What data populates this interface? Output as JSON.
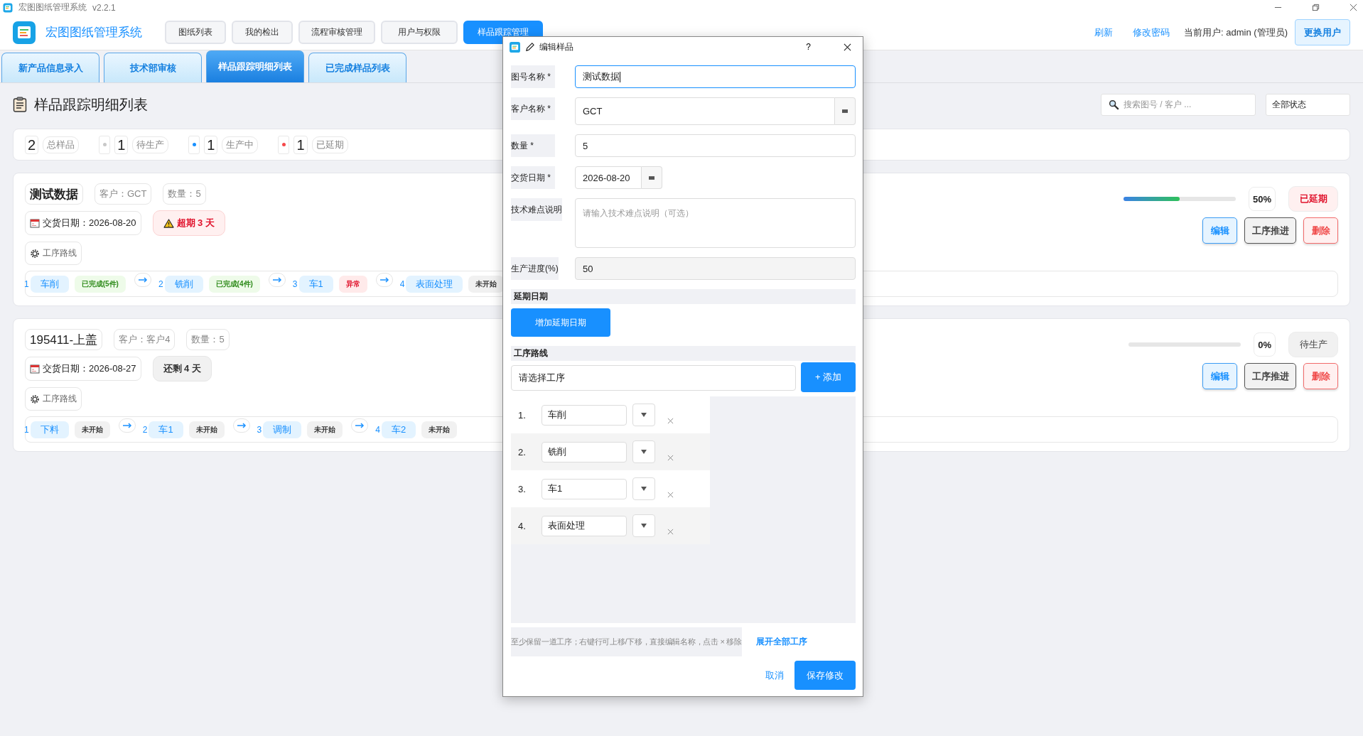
{
  "window": {
    "title": "宏图图纸管理系统",
    "version": "v2.2.1"
  },
  "header": {
    "app_name": "宏图图纸管理系统",
    "nav": [
      {
        "label": "图纸列表",
        "selected": false
      },
      {
        "label": "我的检出",
        "selected": false
      },
      {
        "label": "流程审核管理",
        "selected": false
      },
      {
        "label": "用户与权限",
        "selected": false
      },
      {
        "label": "样品跟踪管理",
        "selected": true
      }
    ],
    "links": [
      "刷新",
      "修改密码"
    ],
    "current_user": "当前用户: admin (管理员)",
    "switch_user": "更换用户"
  },
  "tabs": [
    {
      "label": "新产品信息录入",
      "selected": false
    },
    {
      "label": "技术部审核",
      "selected": false
    },
    {
      "label": "样品跟踪明细列表",
      "selected": true
    },
    {
      "label": "已完成样品列表",
      "selected": false
    }
  ],
  "page": {
    "title": "样品跟踪明细列表",
    "search": {
      "placeholder": "搜索图号 / 客户 ..."
    },
    "status_filter": "全部状态"
  },
  "stats": [
    {
      "value": "2",
      "label": "总样品"
    },
    {
      "value": "1",
      "label": "待生产",
      "color": "#c8c8c8"
    },
    {
      "value": "1",
      "label": "生产中",
      "color": "#1890ff"
    },
    {
      "value": "1",
      "label": "已延期",
      "color": "#f5484a"
    }
  ],
  "samples": [
    {
      "name": "测试数据",
      "customer": "客户：GCT",
      "quantity": "数量：5",
      "delivery": "交货日期：2026-08-20",
      "due": {
        "text": "超期 3 天",
        "kind": "overdue"
      },
      "route_label": "工序路线",
      "steps": [
        {
          "index": "1",
          "name": "车削",
          "status": "已完成(5件)",
          "kind": "done"
        },
        {
          "index": "2",
          "name": "铣削",
          "status": "已完成(4件)",
          "kind": "done"
        },
        {
          "index": "3",
          "name": "车1",
          "status": "异常",
          "kind": "error"
        },
        {
          "index": "4",
          "name": "表面处理",
          "status": "未开始",
          "kind": "pending"
        }
      ],
      "level": 0.5,
      "percent": "50%",
      "status": {
        "label": "已延期",
        "kind": "delayed"
      },
      "actions": [
        "编辑",
        "工序推进",
        "删除"
      ]
    },
    {
      "name": "195411-上盖",
      "customer": "客户：客户4",
      "quantity": "数量：5",
      "delivery": "交货日期：2026-08-27",
      "due": {
        "text": "还剩 4 天",
        "kind": "remaining"
      },
      "route_label": "工序路线",
      "steps": [
        {
          "index": "1",
          "name": "下料",
          "status": "未开始",
          "kind": "pending"
        },
        {
          "index": "2",
          "name": "车1",
          "status": "未开始",
          "kind": "pending"
        },
        {
          "index": "3",
          "name": "调制",
          "status": "未开始",
          "kind": "pending"
        },
        {
          "index": "4",
          "name": "车2",
          "status": "未开始",
          "kind": "pending"
        }
      ],
      "level": 0,
      "percent": "0%",
      "status": {
        "label": "待生产",
        "kind": "waiting"
      },
      "actions": [
        "编辑",
        "工序推进",
        "删除"
      ]
    }
  ],
  "dialog": {
    "title": "编辑样品",
    "help": "?",
    "fields": [
      {
        "label": "图号名称 *",
        "value": "测试数据",
        "kind": "text",
        "focused": true
      },
      {
        "label": "客户名称 *",
        "value": "GCT",
        "kind": "combo",
        "focused": false
      },
      {
        "label": "数量 *",
        "value": "5",
        "kind": "text",
        "focused": false
      },
      {
        "label": "交货日期 *",
        "value": "2026-08-20",
        "kind": "date",
        "focused": false
      },
      {
        "label": "技术难点说明",
        "placeholder": "请输入技术难点说明（可选）",
        "kind": "textarea",
        "focused": false
      },
      {
        "label": "生产进度(%)",
        "value": "50",
        "kind": "readonly",
        "focused": false
      }
    ],
    "delay_section": {
      "title": "延期日期",
      "button": "增加延期日期"
    },
    "route_section": {
      "title": "工序路线",
      "select": "请选择工序",
      "add_button": "+ 添加",
      "steps": [
        {
          "number": "1.",
          "name": "车削"
        },
        {
          "number": "2.",
          "name": "铣削"
        },
        {
          "number": "3.",
          "name": "车1"
        },
        {
          "number": "4.",
          "name": "表面处理"
        }
      ],
      "hint": "至少保留一道工序；右键行可上移/下移，直接编辑名称，点击 × 移除",
      "expand_link": "展开全部工序"
    },
    "cancel": "取消",
    "save": "保存修改"
  }
}
